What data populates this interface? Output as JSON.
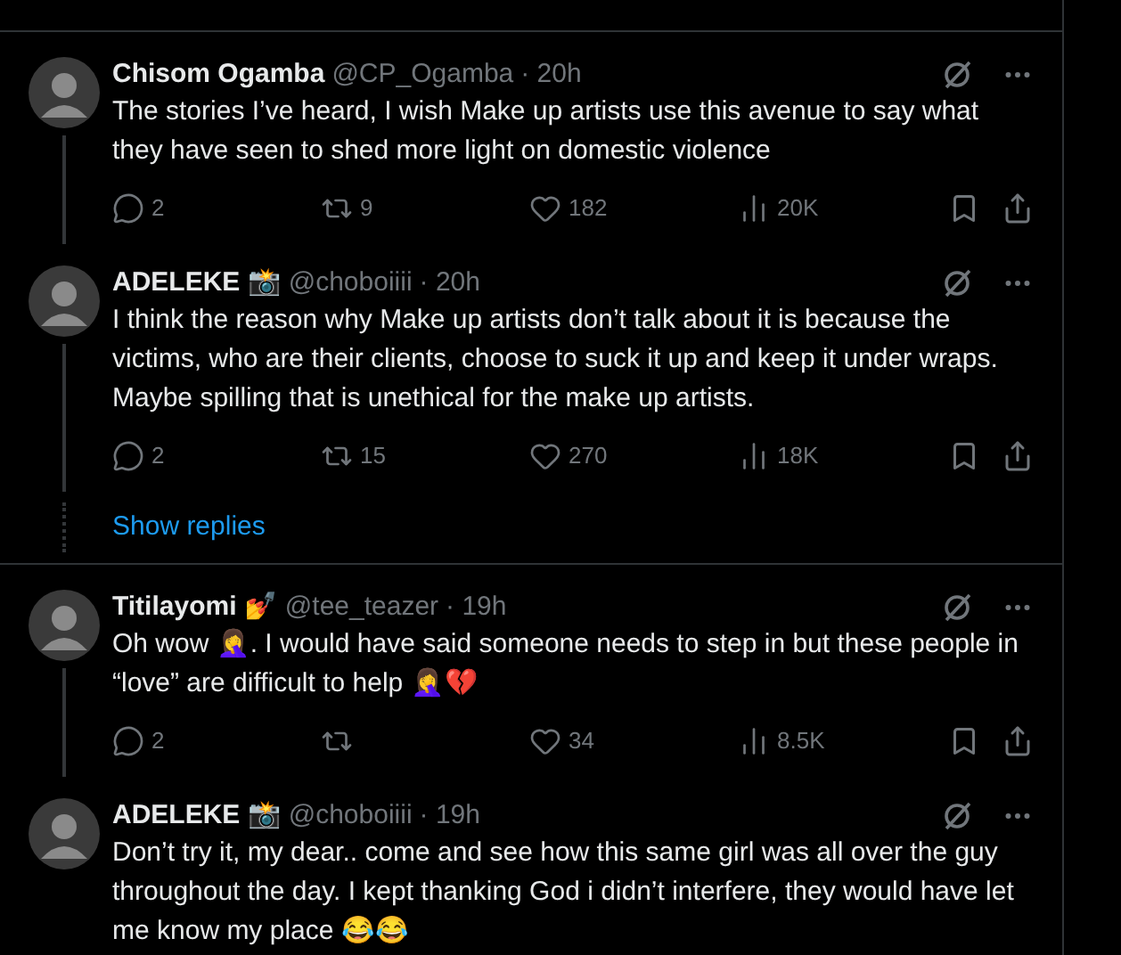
{
  "tweets": [
    {
      "name": "Chisom Ogamba",
      "handle": "@CP_Ogamba",
      "time": "· 20h",
      "text": "The stories I’ve heard, I wish Make up artists use this avenue to say what they have seen to shed more light on domestic violence",
      "stats": {
        "replies": "2",
        "reposts": "9",
        "likes": "182",
        "views": "20K"
      },
      "thread_below": true
    },
    {
      "name": "ADELEKE 📸",
      "handle": "@choboiiii",
      "time": "· 20h",
      "text": "I think the reason why Make up artists don’t talk about it is because the victims, who are their clients, choose to suck it up and keep it under wraps. Maybe spilling that is unethical for the make up artists.",
      "stats": {
        "replies": "2",
        "reposts": "15",
        "likes": "270",
        "views": "18K"
      },
      "thread_below": true,
      "show_replies": "Show replies"
    },
    {
      "name": "Titilayomi 💅",
      "handle": "@tee_teazer",
      "time": "· 19h",
      "text": "Oh wow 🤦‍♀️. I would have said someone needs to step in but these people in “love” are difficult to help 🤦‍♀️💔",
      "stats": {
        "replies": "2",
        "likes": "34",
        "views": "8.5K"
      },
      "thread_below": true
    },
    {
      "name": "ADELEKE 📸",
      "handle": "@choboiiii",
      "time": "· 19h",
      "text": "Don’t try it, my dear.. come and see how this same girl was all over the guy throughout the day. I kept thanking God i didn’t interfere, they would have let me know my place 😂😂",
      "thread_below": false
    }
  ]
}
